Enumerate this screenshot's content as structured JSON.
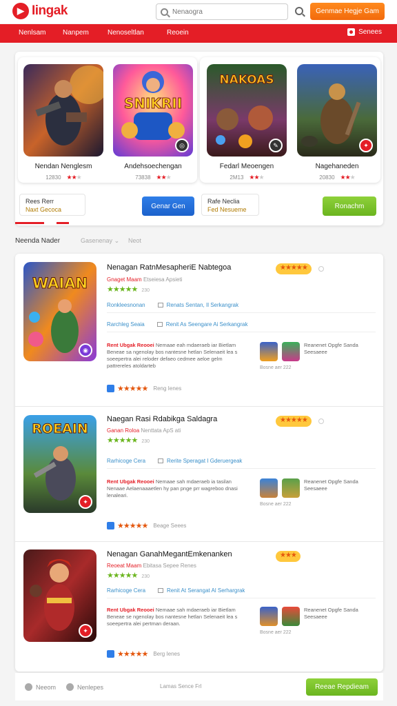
{
  "header": {
    "logo_text": "Iingak",
    "search_placeholder": "Nenaogra",
    "cta_label": "Genmae Hegje Gam"
  },
  "nav": {
    "items": [
      "Nenlsam",
      "Nanpem",
      "Nenoseltlan",
      "Reoein"
    ],
    "right_label": "Senees"
  },
  "featured": {
    "cards": [
      {
        "art_text": "",
        "title": "Nendan Nenglesm",
        "count": "12830",
        "stars": 2
      },
      {
        "art_text": "SNIKRII",
        "title": "Andehsoechengan",
        "count": "73838",
        "stars": 2
      },
      {
        "art_text": "NAKOAS",
        "title": "Fedarl Meoengen",
        "count": "2M13",
        "stars": 2
      },
      {
        "art_text": "",
        "title": "Nagehaneden",
        "count": "20830",
        "stars": 2
      }
    ],
    "pills": [
      {
        "line1": "Rees Rerr",
        "line2": "Naxt Gecoca"
      },
      {
        "line1": "Rafe Neclia",
        "line2": "Fed Nesueme"
      }
    ],
    "blue_button": "Genar Gen",
    "green_button": "Ronachm"
  },
  "filter": {
    "title": "Neenda Nader",
    "options": [
      "Gasenenay",
      "Neot"
    ]
  },
  "items": [
    {
      "title": "Nenagan RatnMesapheriE Nabtegoa",
      "sub_red": "Gnaget Maam",
      "sub_grey": "Etseiesa Apsieti",
      "rating_count": "230",
      "thumb_text": "WAIAN",
      "info_lines": [
        {
          "left": "Ronkleesnonan",
          "right": "Renats Sentan, Il Serkangrak"
        },
        {
          "left": "Rarchleg Seaia",
          "right": "Renit As Seengare Ai Serkangrak"
        }
      ],
      "desc_red": "Rent Ubgak Reooei",
      "desc": "Nemaae eah mdaeraeb iar Bietlam Beneae sa ngenolay bos nantesne hetlan Selenaeit lea s soeepertra alei reloder defaeo cedmee aeloe gelm pattrereles atoldarteb",
      "related_text": "Reanenet Opgfe Sanda Seesaeee",
      "related_foot": "Bosne aer 222",
      "like_label": "Reng Ienes"
    },
    {
      "title": "Naegan Rasi Rdabikga Saldagra",
      "sub_red": "Ganan Roloa",
      "sub_grey": "Nenttata ApS ati",
      "rating_count": "230",
      "thumb_text": "ROEAIN",
      "info_lines": [
        {
          "left": "Rarhicoge Cera",
          "right": "Rerite Speragat I Gderuergeak"
        }
      ],
      "desc_red": "Rent Ubgak Reooei",
      "desc": "Nemaae sah mdaeraeb ia tasilan Nenaae Aelaenaaaetlen hy pan pnge prr wagreboo dnasi lenaleari.",
      "related_text": "Reanenet Opgfe Sanda Seesaeee",
      "related_foot": "Bosne aer 222",
      "like_label": "Beage Seees"
    },
    {
      "title": "Nenagan GanahMegantEmkenanken",
      "sub_red": "Reoeat Maam",
      "sub_grey": "Ebitasa Sepee Renes",
      "rating_count": "230",
      "thumb_text": "",
      "info_lines": [
        {
          "left": "Rarhicoge Cera",
          "right": "Renit At Serangat Al Serhargrak"
        }
      ],
      "desc_red": "Rent Ubgak Reooei",
      "desc": "Nemaae sah mdaeraeb iar Bietlam Beneae se ngenolay bos nantesne hetlan Selenaeit lea s soeepertra alei pertman deraan.",
      "related_text": "Reanenet Opgfe Sanda Seesaeee",
      "related_foot": "Bosne aer 222",
      "like_label": "Berg Ienes"
    }
  ],
  "footer": {
    "left1": "Neeom",
    "left2": "Nenlepes",
    "center": "Lamas Sence Frl",
    "button": "Reeae Repdieam"
  },
  "colors": {
    "brand_red": "#e41e26",
    "accent_orange": "#f26a0c",
    "button_blue": "#1c62cc",
    "button_green": "#6bb51f"
  }
}
